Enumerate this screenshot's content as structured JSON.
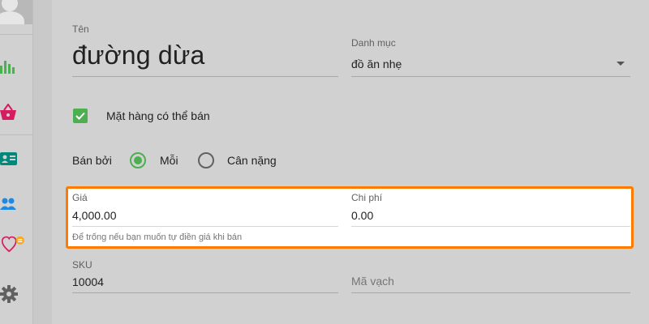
{
  "sidebar": {
    "items": [
      {
        "icon": "avatar",
        "color": "#e6e6e6"
      },
      {
        "icon": "bar-chart-icon",
        "color": "#4caf50"
      },
      {
        "icon": "basket-icon",
        "color": "#d81b60"
      },
      {
        "icon": "contact-card-icon",
        "color": "#00897b"
      },
      {
        "icon": "people-icon",
        "color": "#1e88e5"
      },
      {
        "icon": "heart-badge-icon",
        "color": "#d81b60"
      },
      {
        "icon": "gear-icon",
        "color": "#616161"
      }
    ]
  },
  "form": {
    "name": {
      "label": "Tên",
      "value": "đường dừa"
    },
    "category": {
      "label": "Danh mục",
      "value": "đồ ăn nhẹ"
    },
    "for_sale": {
      "label": "Mặt hàng có thể bán",
      "checked": true
    },
    "sold_by": {
      "label": "Bán bởi",
      "options": [
        {
          "label": "Mỗi",
          "selected": true
        },
        {
          "label": "Cân nặng",
          "selected": false
        }
      ]
    },
    "price": {
      "label": "Giá",
      "value": "4,000.00"
    },
    "cost": {
      "label": "Chi phí",
      "value": "0.00"
    },
    "price_hint": "Để trống nếu bạn muốn tự điền giá khi bán",
    "sku": {
      "label": "SKU",
      "value": "10004"
    },
    "barcode": {
      "placeholder": "Mã vạch"
    }
  },
  "colors": {
    "accent_green": "#4caf50",
    "highlight_orange": "#ff7a00"
  }
}
